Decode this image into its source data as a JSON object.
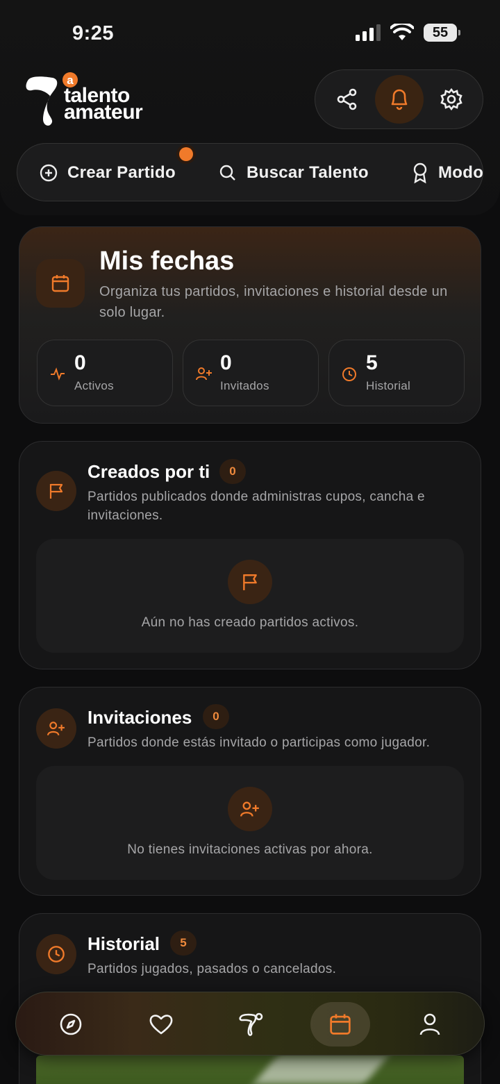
{
  "status_bar": {
    "time": "9:25",
    "battery": "55"
  },
  "brand": {
    "badge_letter": "a",
    "line1": "talento",
    "line2": "amateur"
  },
  "quick_actions": [
    {
      "label": "Crear Partido",
      "icon": "plus-circle-icon"
    },
    {
      "label": "Buscar Talento",
      "icon": "search-icon"
    },
    {
      "label": "Modo",
      "icon": "award-icon"
    }
  ],
  "hero": {
    "title": "Mis fechas",
    "subtitle": "Organiza tus partidos, invitaciones e historial desde un solo lugar.",
    "stats": [
      {
        "value": "0",
        "label": "Activos",
        "icon": "activity-icon"
      },
      {
        "value": "0",
        "label": "Invitados",
        "icon": "user-plus-icon"
      },
      {
        "value": "5",
        "label": "Historial",
        "icon": "clock-icon"
      }
    ]
  },
  "created": {
    "title": "Creados por ti",
    "count": "0",
    "description": "Partidos publicados donde administras cupos, cancha e invitaciones.",
    "empty": "Aún no has creado partidos activos."
  },
  "invitations": {
    "title": "Invitaciones",
    "count": "0",
    "description": "Partidos donde estás invitado o participas como jugador.",
    "empty": "No tienes invitaciones activas por ahora."
  },
  "history": {
    "title": "Historial",
    "count": "5",
    "description": "Partidos jugados, pasados o cancelados."
  },
  "nav": [
    {
      "icon": "compass-icon",
      "active": false
    },
    {
      "icon": "heart-icon",
      "active": false
    },
    {
      "icon": "brand-icon",
      "active": false
    },
    {
      "icon": "calendar-icon",
      "active": true
    },
    {
      "icon": "user-icon",
      "active": false
    }
  ],
  "colors": {
    "accent": "#f07a2a",
    "background": "#0d0d0e",
    "card": "#161617",
    "muted_text": "#a6a6a8"
  }
}
